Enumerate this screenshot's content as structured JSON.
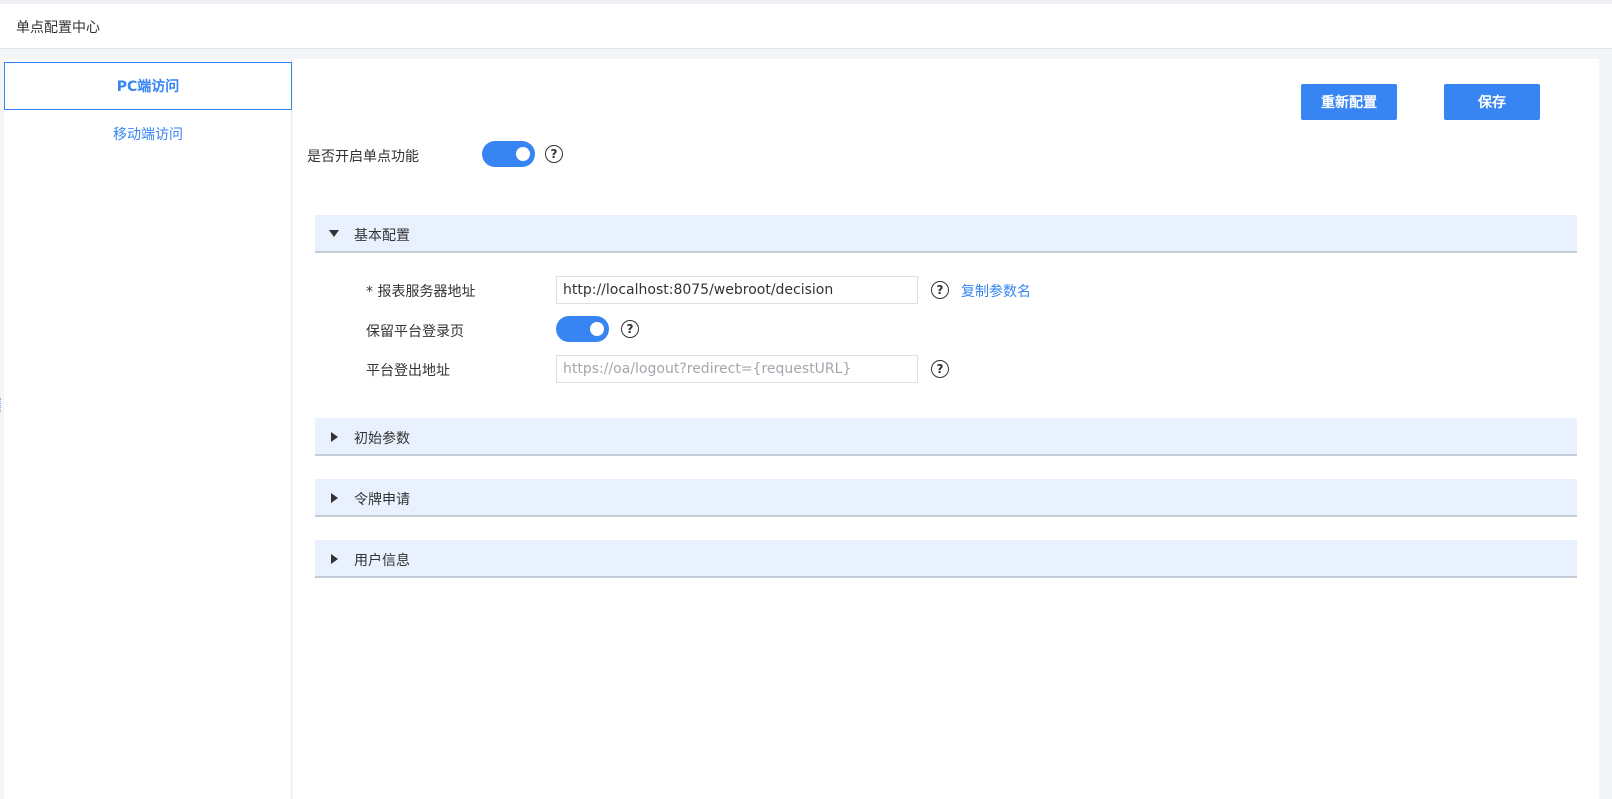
{
  "header": {
    "title": "单点配置中心"
  },
  "sidebar": {
    "items": [
      {
        "label": "PC端访问",
        "active": true
      },
      {
        "label": "移动端访问",
        "active": false
      }
    ]
  },
  "toolbar": {
    "reconfigure_label": "重新配置",
    "save_label": "保存"
  },
  "sso_toggle": {
    "label": "是否开启单点功能",
    "enabled": true
  },
  "sections": {
    "basic": {
      "title": "基本配置",
      "expanded": true,
      "fields": {
        "server_url": {
          "label": "* 报表服务器地址",
          "value": "http://localhost:8075/webroot/decision",
          "copy_link": "复制参数名"
        },
        "keep_login_page": {
          "label": "保留平台登录页",
          "enabled": true
        },
        "logout_url": {
          "label": "平台登出地址",
          "value": "",
          "placeholder": "https://oa/logout?redirect={requestURL}"
        }
      }
    },
    "initial_params": {
      "title": "初始参数",
      "expanded": false
    },
    "token_request": {
      "title": "令牌申请",
      "expanded": false
    },
    "user_info": {
      "title": "用户信息",
      "expanded": false
    }
  },
  "colors": {
    "accent": "#3685f2",
    "section_bg": "#e8f1fd"
  },
  "icons": {
    "help": "question-circle-icon",
    "expanded": "caret-down-icon",
    "collapsed": "caret-right-icon"
  }
}
